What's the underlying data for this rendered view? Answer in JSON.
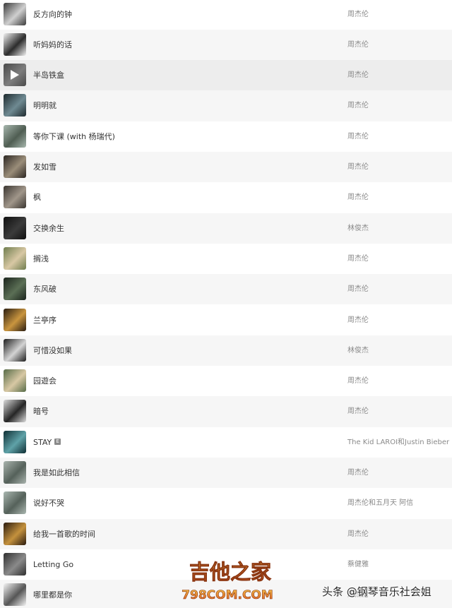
{
  "songs": [
    {
      "title": "反方向的钟",
      "artist": "周杰伦",
      "cover": [
        "#3b3b3b",
        "#cfcfcf"
      ],
      "playing": false
    },
    {
      "title": "听妈妈的话",
      "artist": "周杰伦",
      "cover": [
        "#f2f2f2",
        "#2c2c2c"
      ],
      "playing": false
    },
    {
      "title": "半岛铁盒",
      "artist": "周杰伦",
      "cover": [
        "#4a4a4a",
        "#7d7d7d"
      ],
      "playing": true
    },
    {
      "title": "明明就",
      "artist": "周杰伦",
      "cover": [
        "#1e2a2e",
        "#6f8a92"
      ],
      "playing": false
    },
    {
      "title": "等你下课 (with 杨瑞代)",
      "artist": "周杰伦",
      "cover": [
        "#a7b7ae",
        "#4f5d52"
      ],
      "playing": false
    },
    {
      "title": "发如雪",
      "artist": "周杰伦",
      "cover": [
        "#2b2622",
        "#9a8d79"
      ],
      "playing": false
    },
    {
      "title": "枫",
      "artist": "周杰伦",
      "cover": [
        "#3a3530",
        "#a0968a"
      ],
      "playing": false
    },
    {
      "title": "交换余生",
      "artist": "林俊杰",
      "cover": [
        "#0f0f0f",
        "#3b3b3b"
      ],
      "playing": false
    },
    {
      "title": "搁浅",
      "artist": "周杰伦",
      "cover": [
        "#6f7d4e",
        "#d8c8a4"
      ],
      "playing": false
    },
    {
      "title": "东风破",
      "artist": "周杰伦",
      "cover": [
        "#1b241d",
        "#5b6f55"
      ],
      "playing": false
    },
    {
      "title": "兰亭序",
      "artist": "周杰伦",
      "cover": [
        "#2a1d10",
        "#c9953f"
      ],
      "playing": false
    },
    {
      "title": "可惜没如果",
      "artist": "林俊杰",
      "cover": [
        "#1d1d1d",
        "#d4d4d4"
      ],
      "playing": false
    },
    {
      "title": "园遊会",
      "artist": "周杰伦",
      "cover": [
        "#576b47",
        "#d8c8a4"
      ],
      "playing": false
    },
    {
      "title": "暗号",
      "artist": "周杰伦",
      "cover": [
        "#dcdcdc",
        "#252525"
      ],
      "playing": false
    },
    {
      "title": "STAY",
      "artist": "The Kid LAROI和Justin Bieber",
      "cover": [
        "#0e2e33",
        "#5fa2a8"
      ],
      "playing": false,
      "badge": "E"
    },
    {
      "title": "我是如此相信",
      "artist": "周杰伦",
      "cover": [
        "#a9b3ad",
        "#55615a"
      ],
      "playing": false
    },
    {
      "title": "说好不哭",
      "artist": "周杰伦和五月天 阿信",
      "cover": [
        "#aab7b0",
        "#55615a"
      ],
      "playing": false
    },
    {
      "title": "给我一首歌的时间",
      "artist": "周杰伦",
      "cover": [
        "#2a1b0e",
        "#c4913d"
      ],
      "playing": false
    },
    {
      "title": "Letting Go",
      "artist": "蔡健雅",
      "cover": [
        "#2f2f2f",
        "#8a8a8a"
      ],
      "playing": false
    },
    {
      "title": "哪里都是你",
      "artist": "周杰伦",
      "cover": [
        "#f5f5f5",
        "#555555"
      ],
      "playing": false
    }
  ],
  "watermark": {
    "logo_text": "吉他之家",
    "logo_url": "798COM.COM",
    "credit": "头条 @钢琴音乐社会姐",
    "colors": {
      "logo_top": "#f2c24a",
      "logo_bottom": "#d9541e"
    }
  },
  "colors": {
    "row_alt": "#f6f6f6",
    "row_playing": "#ededed",
    "title": "#333333",
    "artist": "#8a8a8a"
  }
}
